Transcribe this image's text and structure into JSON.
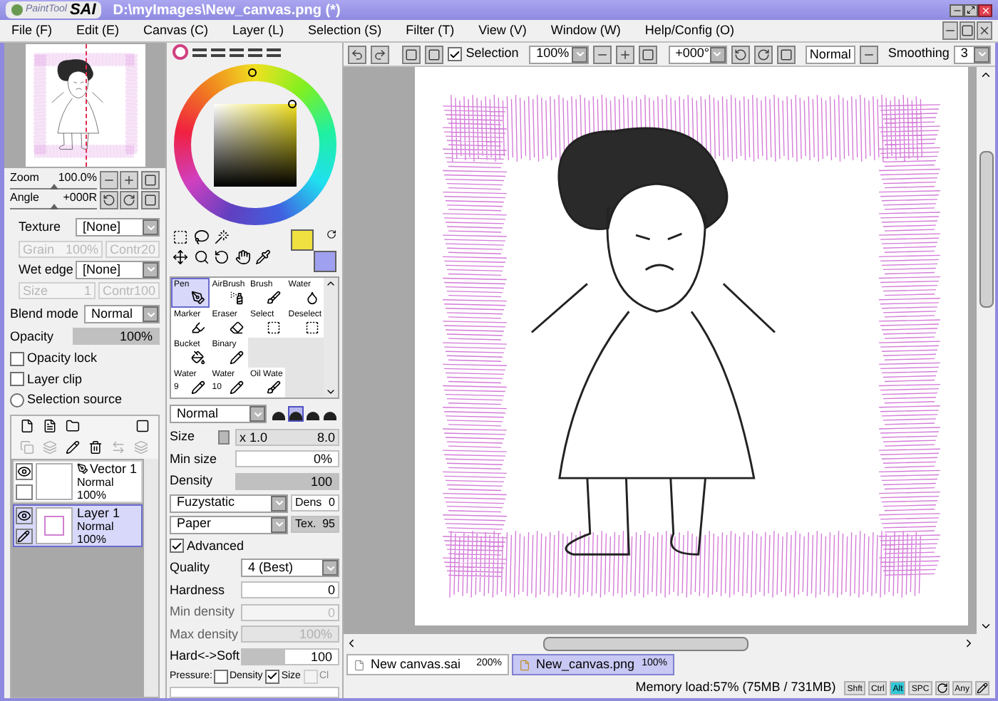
{
  "window": {
    "logo_small": "PaintTool",
    "logo_big": "SAI",
    "title": "D:\\myImages\\New_canvas.png (*)"
  },
  "menu": [
    "File (F)",
    "Edit (E)",
    "Canvas (C)",
    "Layer (L)",
    "Selection (S)",
    "Filter (T)",
    "View (V)",
    "Window (W)",
    "Help/Config (O)"
  ],
  "toolbar": {
    "selection": {
      "label": "Selection",
      "checked": true
    },
    "zoom": "100%",
    "angle": "+000°",
    "blend": "Normal",
    "smoothing_label": "Smoothing",
    "smoothing": "3"
  },
  "navigator": {
    "zoom": {
      "label": "Zoom",
      "value": "100.0%",
      "level": 0.5
    },
    "angle": {
      "label": "Angle",
      "value": "+000R",
      "level": 0.5
    }
  },
  "layer_props": {
    "texture": {
      "label": "Texture",
      "value": "[None]"
    },
    "texture_fields": [
      {
        "label": "Grain",
        "value": "100%",
        "disabled": true
      },
      {
        "label": "Contr",
        "value": "20",
        "disabled": true
      }
    ],
    "wet_edge": {
      "label": "Wet edge",
      "value": "[None]"
    },
    "wet_fields": [
      {
        "label": "Size",
        "value": "1",
        "disabled": true
      },
      {
        "label": "Contr",
        "value": "100",
        "disabled": true
      }
    ],
    "blend_mode": {
      "label": "Blend mode",
      "value": "Normal"
    },
    "opacity": {
      "label": "Opacity",
      "value": "100%",
      "level": 1
    },
    "options": [
      {
        "label": "Opacity lock",
        "kind": "checkbox",
        "checked": false
      },
      {
        "label": "Layer clip",
        "kind": "checkbox",
        "checked": false
      },
      {
        "label": "Selection source",
        "kind": "radio",
        "checked": false
      }
    ]
  },
  "layers": [
    {
      "name": "Vector 1",
      "mode": "Normal",
      "opacity": "100%",
      "kind": "vector",
      "selected": false
    },
    {
      "name": "Layer 1",
      "mode": "Normal",
      "opacity": "100%",
      "kind": "raster",
      "selected": true
    }
  ],
  "brush_rows": [
    [
      {
        "label": "Pen",
        "selected": true
      },
      {
        "label": "AirBrush",
        "selected": false
      },
      {
        "label": "Brush",
        "selected": false
      },
      {
        "label": "Water",
        "selected": false
      }
    ],
    [
      {
        "label": "Marker",
        "selected": false
      },
      {
        "label": "Eraser",
        "selected": false
      },
      {
        "label": "Select",
        "selected": false
      },
      {
        "label": "Deselect",
        "selected": false
      }
    ],
    [
      {
        "label": "Bucket",
        "selected": false
      },
      {
        "label": "Binary",
        "selected": false
      }
    ],
    [
      {
        "label": "Water",
        "number": "9",
        "selected": false
      },
      {
        "label": "Water",
        "number": "10",
        "selected": false
      },
      {
        "label": "Oil Wate",
        "selected": false
      }
    ]
  ],
  "brush": {
    "shape": "Normal",
    "tips": [
      {
        "selected": false
      },
      {
        "selected": true
      },
      {
        "selected": false
      },
      {
        "selected": false
      }
    ],
    "size": {
      "label": "Size",
      "multiplier": "x 1.0",
      "value": "8.0"
    },
    "min_size": {
      "label": "Min size",
      "value": "0%",
      "level": 0
    },
    "density": {
      "label": "Density",
      "value": "100",
      "level": 1
    },
    "texture": {
      "value": "Fuzystatic",
      "label": "Dens",
      "amount": "0"
    },
    "paper": {
      "value": "Paper",
      "label": "Tex.",
      "amount": "95"
    },
    "advanced": {
      "label": "Advanced",
      "checked": true
    },
    "rows": [
      {
        "label": "Quality",
        "value": "4 (Best)",
        "kind": "dropdown",
        "disabled": false
      },
      {
        "label": "Hardness",
        "value": "0",
        "kind": "field",
        "disabled": false
      },
      {
        "label": "Min density",
        "value": "0",
        "kind": "field",
        "disabled": true
      },
      {
        "label": "Max density",
        "value": "100%",
        "kind": "slider",
        "level": 1,
        "disabled": true
      },
      {
        "label": "Hard<->Soft",
        "value": "100",
        "kind": "slider",
        "level": 0.45,
        "disabled": false
      }
    ],
    "pressure": {
      "label": "Pressure:",
      "options": [
        {
          "label": "Density",
          "checked": false,
          "disabled": false
        },
        {
          "label": "Size",
          "checked": true,
          "disabled": false
        },
        {
          "label": "Cl",
          "checked": false,
          "disabled": true
        }
      ]
    }
  },
  "documents": [
    {
      "name": "New canvas.sai",
      "zoom": "200%",
      "selected": false
    },
    {
      "name": "New_canvas.png",
      "zoom": "100%",
      "selected": true
    }
  ],
  "status": {
    "memory": "Memory load:57% (75MB / 731MB)",
    "keys": [
      {
        "kind": "key",
        "label": "Shft",
        "active": false
      },
      {
        "kind": "key",
        "label": "Ctrl",
        "active": false
      },
      {
        "kind": "key",
        "label": "Alt",
        "active": true
      },
      {
        "kind": "key",
        "label": "SPC",
        "active": false
      },
      {
        "kind": "rotate"
      },
      {
        "kind": "key",
        "label": "Any",
        "active": false
      },
      {
        "kind": "pen"
      }
    ]
  }
}
